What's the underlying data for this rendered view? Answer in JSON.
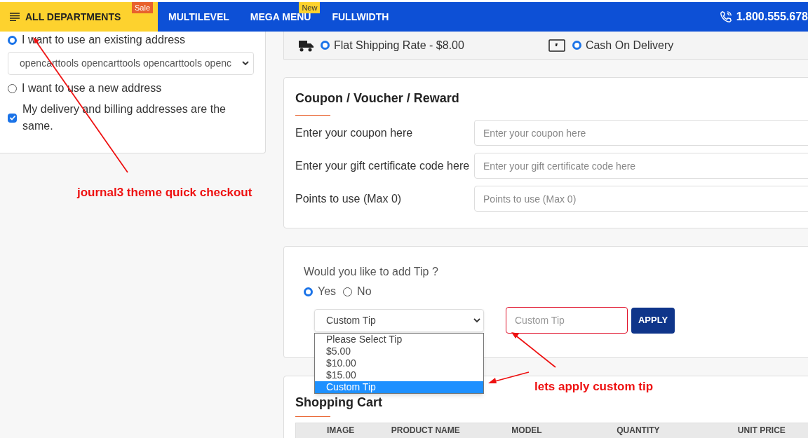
{
  "header": {
    "menu_button": {
      "label": "ALL DEPARTMENTS",
      "badge": "Sale"
    },
    "nav": [
      {
        "label": "MULTILEVEL"
      },
      {
        "label": "MEGA MENU",
        "badge": "New"
      },
      {
        "label": "FULLWIDTH"
      }
    ],
    "phone": "1.800.555.678"
  },
  "address": {
    "options": [
      {
        "label": "I want to use an existing address",
        "selected": true
      },
      {
        "label": "I want to use a new address",
        "selected": false
      }
    ],
    "address_select": "opencarttools opencarttools opencarttools openc",
    "same_address": {
      "label": "My delivery and billing addresses are the same.",
      "checked": true
    }
  },
  "shipping": {
    "label": "Flat Shipping Rate - $8.00",
    "selected": true
  },
  "payment": {
    "label": "Cash On Delivery",
    "selected": true
  },
  "coupon": {
    "title": "Coupon / Voucher / Reward",
    "fields": [
      {
        "label": "Enter your coupon here",
        "placeholder": "Enter your coupon here"
      },
      {
        "label": "Enter your gift certificate code here",
        "placeholder": "Enter your gift certificate code here"
      },
      {
        "label": "Points to use (Max 0)",
        "placeholder": "Points to use (Max 0)"
      }
    ]
  },
  "tip": {
    "question": "Would you like to add Tip ?",
    "choices": [
      {
        "label": "Yes",
        "selected": true
      },
      {
        "label": "No",
        "selected": false
      }
    ],
    "select": {
      "value": "Custom Tip",
      "expanded": true,
      "options": [
        {
          "label": "Please Select Tip",
          "selected": false
        },
        {
          "label": "$5.00",
          "selected": false
        },
        {
          "label": "$10.00",
          "selected": false
        },
        {
          "label": "$15.00",
          "selected": false
        },
        {
          "label": "Custom Tip",
          "selected": true
        }
      ]
    },
    "custom_placeholder": "Custom Tip",
    "apply": "APPLY"
  },
  "cart": {
    "title": "Shopping Cart",
    "columns": [
      "IMAGE",
      "PRODUCT NAME",
      "MODEL",
      "QUANTITY",
      "UNIT PRICE"
    ]
  },
  "annotations": [
    {
      "text": "journal3 theme quick checkout"
    },
    {
      "text": "lets apply custom tip"
    }
  ]
}
